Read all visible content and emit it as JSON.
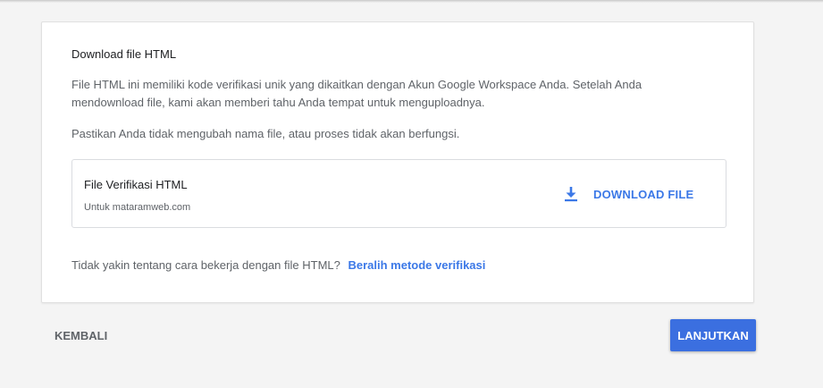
{
  "card": {
    "title": "Download file HTML",
    "description": "File HTML ini memiliki kode verifikasi unik yang dikaitkan dengan Akun Google Workspace Anda. Setelah Anda mendownload file, kami akan memberi tahu Anda tempat untuk menguploadnya.",
    "warning": "Pastikan Anda tidak mengubah nama file, atau proses tidak akan berfungsi."
  },
  "file": {
    "name": "File Verifikasi HTML",
    "domain": "Untuk mataramweb.com",
    "download_label": "DOWNLOAD FILE",
    "icon": "download-icon"
  },
  "help": {
    "question": "Tidak yakin tentang cara bekerja dengan file HTML?",
    "link": "Beralih metode verifikasi"
  },
  "footer": {
    "back_label": "KEMBALI",
    "continue_label": "LANJUTKAN"
  },
  "colors": {
    "accent": "#3b78e7",
    "button": "#3b6fe0",
    "background": "#f4f4f4"
  }
}
